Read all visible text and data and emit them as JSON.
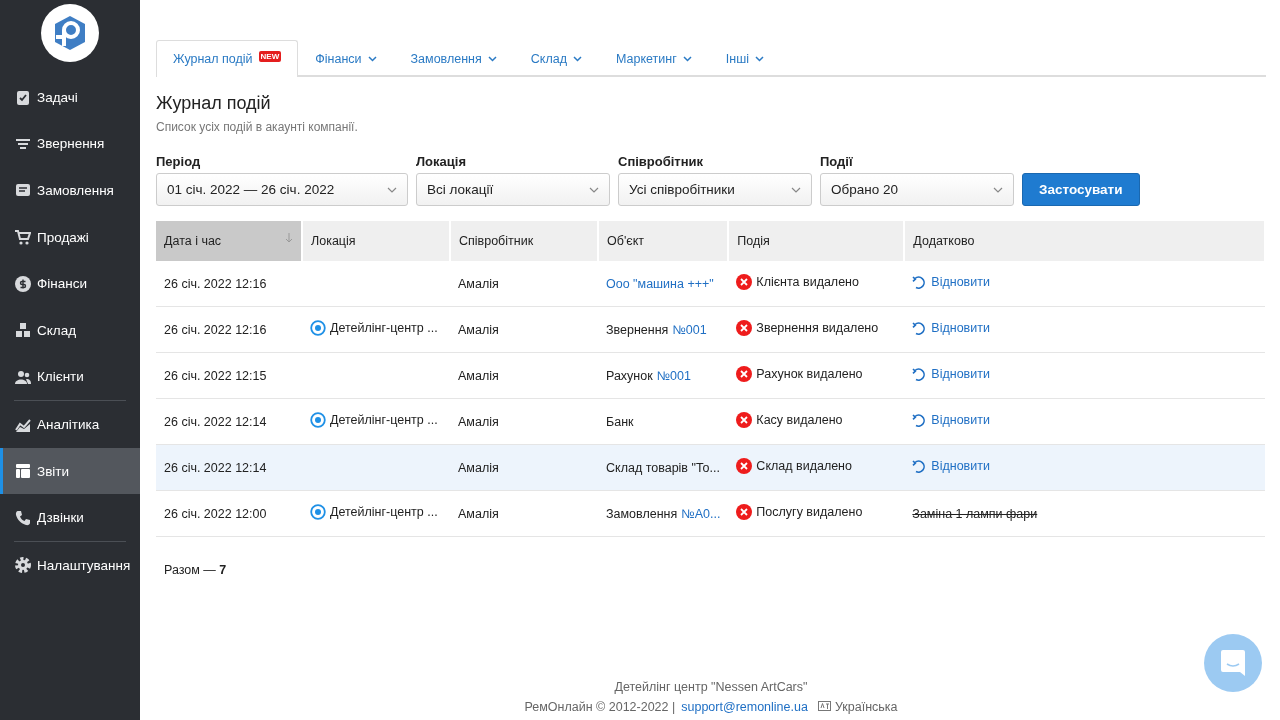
{
  "sidebar": {
    "items": [
      {
        "label": "Задачі",
        "selected": false,
        "divider_after": false
      },
      {
        "label": "Звернення",
        "selected": false,
        "divider_after": false
      },
      {
        "label": "Замовлення",
        "selected": false,
        "divider_after": false
      },
      {
        "label": "Продажі",
        "selected": false,
        "divider_after": false
      },
      {
        "label": "Фінанси",
        "selected": false,
        "divider_after": false
      },
      {
        "label": "Склад",
        "selected": false,
        "divider_after": false
      },
      {
        "label": "Клієнти",
        "selected": false,
        "divider_after": true
      },
      {
        "label": "Аналітика",
        "selected": false,
        "divider_after": false
      },
      {
        "label": "Звіти",
        "selected": true,
        "divider_after": false
      },
      {
        "label": "Дзвінки",
        "selected": false,
        "divider_after": true
      },
      {
        "label": "Налаштування",
        "selected": false,
        "divider_after": false
      }
    ]
  },
  "tabs": [
    {
      "label": "Журнал подій",
      "badge": "NEW",
      "has_menu": false,
      "selected": true
    },
    {
      "label": "Фінанси",
      "has_menu": true,
      "selected": false
    },
    {
      "label": "Замовлення",
      "has_menu": true,
      "selected": false
    },
    {
      "label": "Склад",
      "has_menu": true,
      "selected": false
    },
    {
      "label": "Маркетинг",
      "has_menu": true,
      "selected": false
    },
    {
      "label": "Інші",
      "has_menu": true,
      "selected": false
    }
  ],
  "page": {
    "title": "Журнал подій",
    "subtitle": "Список усіх подій в акаунті компанії."
  },
  "filters": [
    {
      "label": "Період",
      "value": "01 січ. 2022 — 26 січ. 2022"
    },
    {
      "label": "Локація",
      "value": "Всі локації"
    },
    {
      "label": "Співробітник",
      "value": "Усі співробітники"
    },
    {
      "label": "Події",
      "value": "Обрано 20"
    }
  ],
  "apply_button": "Застосувати",
  "table": {
    "columns": [
      {
        "label": "Дата і час",
        "sorted": true
      },
      {
        "label": "Локація",
        "sorted": false
      },
      {
        "label": "Співробітник",
        "sorted": false
      },
      {
        "label": "Об'єкт",
        "sorted": false
      },
      {
        "label": "Подія",
        "sorted": false
      },
      {
        "label": "Додатково",
        "sorted": false
      }
    ],
    "rows": [
      {
        "date": "26 січ. 2022 12:16",
        "employee": "Амалія",
        "object_link": "Ооо \"машина +++\"",
        "event": "Клієнта видалено",
        "extra": {
          "kind": "restore",
          "text": "Відновити"
        },
        "highlighted": false
      },
      {
        "date": "26 січ. 2022 12:16",
        "location": "Детейлінг-центр ...",
        "employee": "Амалія",
        "object_text": "Звернення",
        "object_link": "№001",
        "event": "Звернення видалено",
        "extra": {
          "kind": "restore",
          "text": "Відновити"
        },
        "highlighted": false
      },
      {
        "date": "26 січ. 2022 12:15",
        "employee": "Амалія",
        "object_text": "Рахунок",
        "object_link": "№001",
        "event": "Рахунок видалено",
        "extra": {
          "kind": "restore",
          "text": "Відновити"
        },
        "highlighted": false
      },
      {
        "date": "26 січ. 2022 12:14",
        "location": "Детейлінг-центр ...",
        "employee": "Амалія",
        "object_text": "Банк",
        "event": "Касу видалено",
        "extra": {
          "kind": "restore",
          "text": "Відновити"
        },
        "highlighted": false
      },
      {
        "date": "26 січ. 2022 12:14",
        "employee": "Амалія",
        "object_text": "Склад товарів \"То...",
        "event": "Склад видалено",
        "extra": {
          "kind": "restore",
          "text": "Відновити"
        },
        "highlighted": true
      },
      {
        "date": "26 січ. 2022 12:00",
        "location": "Детейлінг-центр ...",
        "employee": "Амалія",
        "object_text": "Замовлення",
        "object_link": "№А0...",
        "event": "Послугу видалено",
        "extra": {
          "kind": "struck",
          "text": "Заміна 1 лампи фари"
        },
        "highlighted": false
      }
    ],
    "total": "Разом — **7**"
  },
  "footer": {
    "company": "Детейлінг центр \"Nessen ArtCars\"",
    "copyright": "РемОнлайн © 2012-2022 |",
    "email": "support@remonline.ua",
    "language": "Українська"
  }
}
